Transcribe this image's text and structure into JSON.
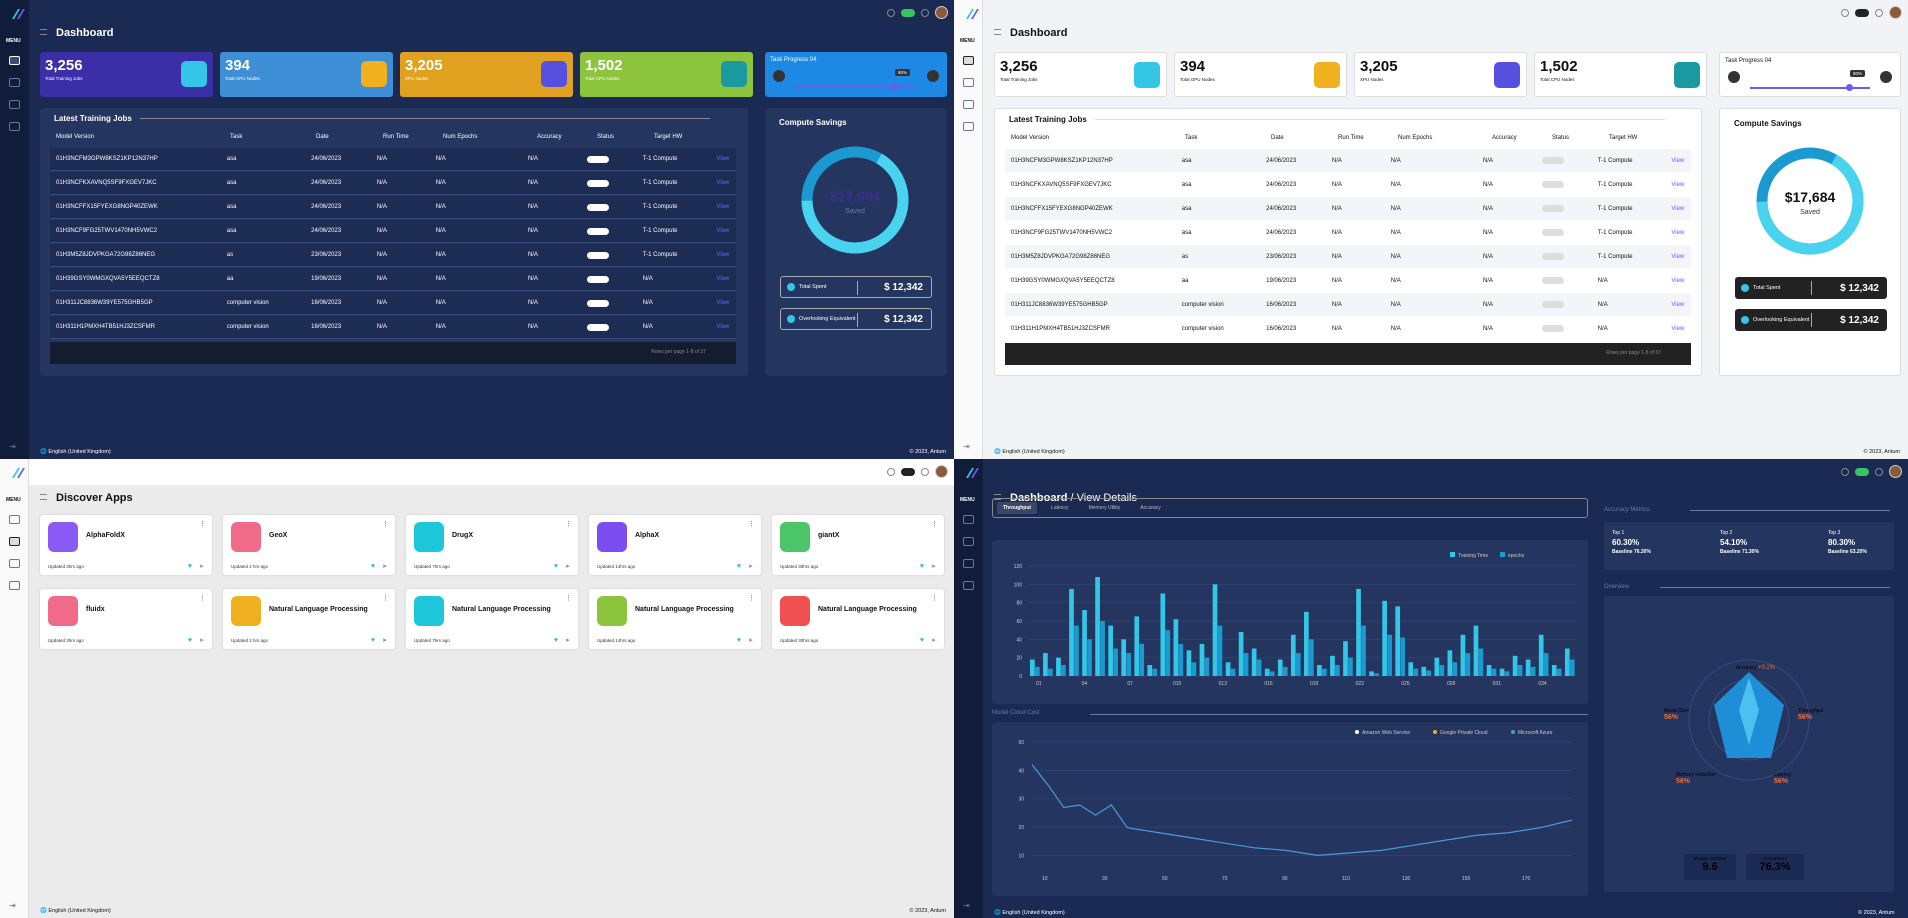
{
  "top_dark": {
    "page_title": "Dashboard",
    "menu_label": "MENU",
    "stats": [
      {
        "value": "3,256",
        "label": "Total Training Jobs",
        "color": "#3b2fa8"
      },
      {
        "value": "394",
        "label": "Total GPU Nodes",
        "color": "#3f8fd6"
      },
      {
        "value": "3,205",
        "label": "XPU Nodes",
        "color": "#e0a020"
      },
      {
        "value": "1,502",
        "label": "Total CPU Nodes",
        "color": "#8cc43e"
      }
    ],
    "task_progress": {
      "title": "Task Progress 04",
      "badge": "80%",
      "fraction": 0.8
    },
    "latest_title": "Latest Training Jobs",
    "columns": [
      "Model Version",
      "Task",
      "Date",
      "Run Time",
      "Num Epochs",
      "Accuracy",
      "Status",
      "Target HW"
    ],
    "rows": [
      {
        "model": "01H3NCFM3GPW8KSZ1KP12N37HP",
        "task": "asa",
        "date": "24/06/2023",
        "run": "N/A",
        "epochs": "N/A",
        "acc": "N/A",
        "hw": "T-1 Compute",
        "view": "View"
      },
      {
        "model": "01H3NCFKXAVNQ5SF9FXGEV7JKC",
        "task": "asa",
        "date": "24/06/2023",
        "run": "N/A",
        "epochs": "N/A",
        "acc": "N/A",
        "hw": "T-1 Compute",
        "view": "View"
      },
      {
        "model": "01H3NCFFX15FYEXG8NGP40ZEWK",
        "task": "asa",
        "date": "24/06/2023",
        "run": "N/A",
        "epochs": "N/A",
        "acc": "N/A",
        "hw": "T-1 Compute",
        "view": "View"
      },
      {
        "model": "01H3NCF9FG25TWV1470NH5VWC2",
        "task": "asa",
        "date": "24/06/2023",
        "run": "N/A",
        "epochs": "N/A",
        "acc": "N/A",
        "hw": "T-1 Compute",
        "view": "View"
      },
      {
        "model": "01H3M5Z8JDVPKGA72G98Z86NEG",
        "task": "as",
        "date": "23/06/2023",
        "run": "N/A",
        "epochs": "N/A",
        "acc": "N/A",
        "hw": "T-1 Compute",
        "view": "View"
      },
      {
        "model": "01H39GSY0WMGXQVA5Y5EEQCTZ8",
        "task": "aa",
        "date": "19/06/2023",
        "run": "N/A",
        "epochs": "N/A",
        "acc": "N/A",
        "hw": "N/A",
        "view": "View"
      },
      {
        "model": "01H311JC8836W39YE575GHB5GP",
        "task": "computer vision",
        "date": "16/06/2023",
        "run": "N/A",
        "epochs": "N/A",
        "acc": "N/A",
        "hw": "N/A",
        "view": "View"
      },
      {
        "model": "01H311H1PMXH4TB51HJ3ZCSFMR",
        "task": "computer vision",
        "date": "16/06/2023",
        "run": "N/A",
        "epochs": "N/A",
        "acc": "N/A",
        "hw": "N/A",
        "view": "View"
      }
    ],
    "pagination": "Rows per page   1-8 of 37",
    "savings_title": "Compute Savings",
    "savings_value": "$17,684",
    "savings_sub": "Saved",
    "total_spent_label": "Total Spent",
    "total_spent_value": "$ 12,342",
    "overlooking_label": "Overlooking Equivalent",
    "overlooking_value": "$ 12,342",
    "footer_lang": "English (United Kingdom)",
    "footer_copy": "© 2023, Antum"
  },
  "apps": {
    "title": "Discover Apps",
    "items": [
      {
        "name": "AlphaFoldX",
        "updated": "Updated 3hrs ago",
        "color": "#8a5cf5"
      },
      {
        "name": "GeoX",
        "updated": "Updated 2 hrs ago",
        "color": "#f06a8a"
      },
      {
        "name": "DrugX",
        "updated": "Updated 7hrs ago",
        "color": "#1dc6d8"
      },
      {
        "name": "AlphaX",
        "updated": "Updated 14hrs ago",
        "color": "#7a4ef0"
      },
      {
        "name": "giantX",
        "updated": "Updated 30hrs ago",
        "color": "#4cc46a"
      },
      {
        "name": "fluidx",
        "updated": "Updated 3hrs ago",
        "color": "#f06a8a"
      },
      {
        "name": "Natural Language Processing",
        "updated": "Updated 2 hrs ago",
        "color": "#f0b020"
      },
      {
        "name": "Natural Language Processing",
        "updated": "Updated 7hrs ago",
        "color": "#1dc6d8"
      },
      {
        "name": "Natural Language Processing",
        "updated": "Updated 14hrs ago",
        "color": "#8cc43e"
      },
      {
        "name": "Natural Language Processing",
        "updated": "Updated 30hrs ago",
        "color": "#f05050"
      }
    ],
    "footer_lang": "English (United Kingdom)",
    "footer_copy": "© 2023, Antum"
  },
  "details": {
    "title": "Dashboard",
    "subtitle": "/ View Details",
    "tabs": [
      "Throughput",
      "Latency",
      "Memory Utility",
      "Accuracy"
    ],
    "legend": [
      "Training Time",
      "epochs"
    ],
    "bar_xticks": [
      "01",
      "04",
      "07",
      "010",
      "013",
      "016",
      "019",
      "022",
      "025",
      "028",
      "031",
      "034"
    ],
    "bar_yticks": [
      "0",
      "20",
      "40",
      "60",
      "80",
      "100",
      "120"
    ],
    "line_section": "Model Cloud Cost",
    "line_legend": [
      "Amazon Web Service",
      "Google Private Cloud",
      "Microsoft Azure"
    ],
    "line_yticks": [
      "50",
      "40",
      "30",
      "20",
      "10"
    ],
    "line_xticks": [
      "10",
      "30",
      "50",
      "70",
      "90",
      "110",
      "130",
      "150",
      "170"
    ],
    "metrics_title": "Accuracy Metrics",
    "tops": [
      {
        "name": "Top 1",
        "value": "60.30%",
        "baseline": "Baseline 76.30%"
      },
      {
        "name": "Top 2",
        "value": "54.10%",
        "baseline": "Baseline 71.30%"
      },
      {
        "name": "Top 3",
        "value": "80.30%",
        "baseline": "Baseline 63.20%"
      }
    ],
    "overview_title": "Overview",
    "radar": {
      "accuracy": "Accuracy",
      "accuracy_delta": "+0.2%",
      "throughput": "Throughput",
      "throughput_val": "56%",
      "latency": "Latency",
      "latency_val": "56%",
      "memory": "Memory reduction",
      "memory_val": "56%",
      "model_size": "Model Size",
      "model_size_val": "56%"
    },
    "model_score_label": "MODEL SCORE",
    "model_score": "9.6",
    "accuracy_label": "ACCURACY",
    "accuracy": "76.3%",
    "footer_lang": "English (United Kingdom)",
    "footer_copy": "© 2023, Antum"
  },
  "chart_data": [
    {
      "type": "bar",
      "title": "",
      "legend": [
        "Training Time",
        "epochs"
      ],
      "ylim": [
        0,
        120
      ],
      "series": [
        {
          "name": "Training Time",
          "values": [
            18,
            25,
            20,
            95,
            72,
            108,
            55,
            40,
            65,
            12,
            90,
            62,
            28,
            35,
            100,
            15,
            48,
            30,
            8,
            18,
            45,
            70,
            12,
            22,
            38,
            95,
            5,
            82,
            76,
            15,
            10,
            20,
            28,
            45,
            55,
            12,
            8,
            22,
            18,
            45,
            12,
            30
          ]
        },
        {
          "name": "epochs",
          "values": [
            10,
            8,
            12,
            55,
            40,
            60,
            30,
            25,
            35,
            8,
            50,
            35,
            15,
            20,
            55,
            8,
            25,
            18,
            5,
            10,
            25,
            40,
            8,
            12,
            20,
            55,
            3,
            45,
            42,
            8,
            6,
            12,
            15,
            25,
            30,
            8,
            5,
            12,
            10,
            25,
            8,
            18
          ]
        }
      ]
    },
    {
      "type": "line",
      "title": "Model Cloud Cost",
      "ylim": [
        5,
        55
      ],
      "x": [
        10,
        15,
        20,
        25,
        30,
        35,
        40,
        50,
        60,
        70,
        80,
        90,
        100,
        110,
        120,
        130,
        140,
        150,
        160,
        170,
        180
      ],
      "series": [
        {
          "name": "",
          "values": [
            46,
            38,
            29,
            30,
            26,
            30,
            21,
            19,
            17,
            15,
            13,
            12,
            10,
            11,
            12,
            14,
            16,
            18,
            19,
            21,
            24
          ]
        }
      ]
    }
  ]
}
